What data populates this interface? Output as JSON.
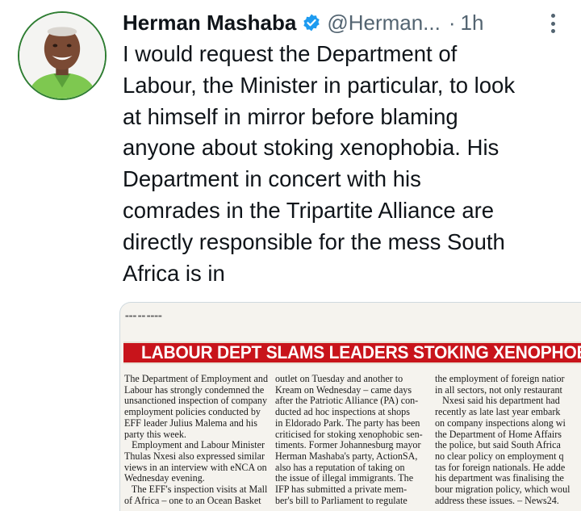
{
  "tweet": {
    "display_name": "Herman Mashaba",
    "handle": "@Herman...",
    "separator": "·",
    "time": "1h",
    "text": "I would request the Department of\nLabour, the Minister in particular, to look\nat himself in mirror before blaming\nanyone about stoking xenophobia. His\nDepartment in concert with his\ncomrades in the Tripartite Alliance are\ndirectly responsible for the mess South\nAfrica is in"
  },
  "media": {
    "headline": "LABOUR DEPT SLAMS LEADERS STOKING XENOPHOBIA",
    "columns": [
      "The Department of Employment and\nLabour has strongly condemned the\nunsanctioned inspection of company\nemployment policies conducted by\nEFF leader Julius Malema and his\nparty this week.\n   Employment and Labour Minister\nThulas Nxesi also expressed similar\nviews in an interview with eNCA on\nWednesday evening.\n   The EFF's inspection visits at Mall\nof Africa – one to an Ocean Basket",
      "outlet on Tuesday and another to\nKream on Wednesday – came days\nafter the Patriotic Alliance (PA) con-\nducted ad hoc inspections at shops\nin Eldorado Park. The party has been\ncriticised for stoking xenophobic sen-\ntiments. Former Johannesburg mayor\nHerman Mashaba's party, ActionSA,\nalso has a reputation of taking on\nthe issue of illegal immigrants. The\nIFP has submitted a private mem-\nber's bill to Parliament to regulate",
      "the employment of foreign natior\nin all sectors, not only restaurant\n   Nxesi said his department had\nrecently as late last year embark\non company inspections along wi\nthe Department of Home Affairs\nthe police, but said South Africa\nno clear policy on employment q\ntas for foreign nationals. He adde\nhis department was finalising the\nbour migration policy, which woul\naddress these issues. – News24."
    ]
  },
  "colors": {
    "headline_bg": "#c8141b",
    "verified": "#1d9bf0",
    "muted": "#536471"
  },
  "icons": {
    "verified": "verified-badge-icon",
    "more": "more-options-icon"
  }
}
